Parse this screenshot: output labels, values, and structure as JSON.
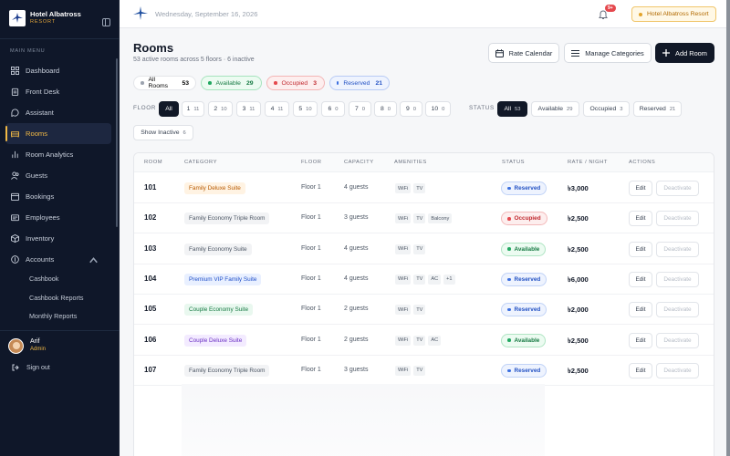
{
  "brand": {
    "name": "Hotel Albatross",
    "sub": "RESORT"
  },
  "sidebar": {
    "menu_label": "MAIN MENU",
    "items": [
      {
        "label": "Dashboard",
        "icon": "grid-icon"
      },
      {
        "label": "Front Desk",
        "icon": "clipboard-icon"
      },
      {
        "label": "Assistant",
        "icon": "chat-icon"
      },
      {
        "label": "Rooms",
        "icon": "bed-icon",
        "active": true
      },
      {
        "label": "Room Analytics",
        "icon": "bar-chart-icon"
      },
      {
        "label": "Guests",
        "icon": "users-icon"
      },
      {
        "label": "Bookings",
        "icon": "calendar-icon"
      },
      {
        "label": "Employees",
        "icon": "id-card-icon"
      },
      {
        "label": "Inventory",
        "icon": "box-icon"
      },
      {
        "label": "Accounts",
        "icon": "wallet-icon"
      }
    ],
    "sub_items": [
      "Cashbook",
      "Cashbook Reports",
      "Monthly Reports"
    ],
    "user": {
      "name": "Arif",
      "role": "Admin"
    },
    "signout": "Sign out"
  },
  "topbar": {
    "date": "Wednesday, September 16, 2026",
    "notif_badge": "9+",
    "hotel": "Hotel Albatross Resort"
  },
  "page": {
    "title": "Rooms",
    "subtitle": "53 active rooms across 5 floors · 6 inactive"
  },
  "actions": {
    "rate_calendar": "Rate Calendar",
    "manage_categories": "Manage Categories",
    "add_room": "Add Room"
  },
  "summary": [
    {
      "label": "All Rooms",
      "count": "53",
      "color": "#9ca3af"
    },
    {
      "label": "Available",
      "count": "29",
      "color": "#22a861"
    },
    {
      "label": "Occupied",
      "count": "3",
      "color": "#e5484d"
    },
    {
      "label": "Reserved",
      "count": "21",
      "color": "#3b6fe0"
    }
  ],
  "filters": {
    "floor_label": "FLOOR",
    "floors": [
      {
        "label": "All",
        "count": ""
      },
      {
        "label": "1",
        "count": "11"
      },
      {
        "label": "2",
        "count": "10"
      },
      {
        "label": "3",
        "count": "11"
      },
      {
        "label": "4",
        "count": "11"
      },
      {
        "label": "5",
        "count": "10"
      },
      {
        "label": "6",
        "count": "0"
      },
      {
        "label": "7",
        "count": "0"
      },
      {
        "label": "8",
        "count": "0"
      },
      {
        "label": "9",
        "count": "0"
      },
      {
        "label": "10",
        "count": "0"
      }
    ],
    "status_label": "STATUS",
    "statuses": [
      {
        "label": "All",
        "count": "53"
      },
      {
        "label": "Available",
        "count": "29"
      },
      {
        "label": "Occupied",
        "count": "3"
      },
      {
        "label": "Reserved",
        "count": "21"
      }
    ],
    "show_inactive": {
      "label": "Show Inactive",
      "count": "6"
    }
  },
  "table": {
    "headers": [
      "ROOM",
      "CATEGORY",
      "FLOOR",
      "CAPACITY",
      "AMENITIES",
      "STATUS",
      "RATE / NIGHT",
      "ACTIONS"
    ],
    "edit_label": "Edit",
    "deactivate_label": "Deactivate",
    "rows": [
      {
        "room": "101",
        "category": "Family Deluxe Suite",
        "cat_style": "orange",
        "floor": "Floor 1",
        "capacity": "4 guests",
        "amenities": [
          "WiFi",
          "TV"
        ],
        "status": "Reserved",
        "rate": "৳3,000"
      },
      {
        "room": "102",
        "category": "Family Economy Triple Room",
        "cat_style": "gray",
        "floor": "Floor 1",
        "capacity": "3 guests",
        "amenities": [
          "WiFi",
          "TV",
          "Balcony"
        ],
        "status": "Occupied",
        "rate": "৳2,500"
      },
      {
        "room": "103",
        "category": "Family Economy Suite",
        "cat_style": "gray",
        "floor": "Floor 1",
        "capacity": "4 guests",
        "amenities": [
          "WiFi",
          "TV"
        ],
        "status": "Available",
        "rate": "৳2,500"
      },
      {
        "room": "104",
        "category": "Premium VIP Family Suite",
        "cat_style": "blue",
        "floor": "Floor 1",
        "capacity": "4 guests",
        "amenities": [
          "WiFi",
          "TV",
          "AC",
          "+1"
        ],
        "status": "Reserved",
        "rate": "৳6,000"
      },
      {
        "room": "105",
        "category": "Couple Economy Suite",
        "cat_style": "green",
        "floor": "Floor 1",
        "capacity": "2 guests",
        "amenities": [
          "WiFi",
          "TV"
        ],
        "status": "Reserved",
        "rate": "৳2,000"
      },
      {
        "room": "106",
        "category": "Couple Deluxe Suite",
        "cat_style": "purple",
        "floor": "Floor 1",
        "capacity": "2 guests",
        "amenities": [
          "WiFi",
          "TV",
          "AC"
        ],
        "status": "Available",
        "rate": "৳2,500"
      },
      {
        "room": "107",
        "category": "Family Economy Triple Room",
        "cat_style": "gray",
        "floor": "Floor 1",
        "capacity": "3 guests",
        "amenities": [
          "WiFi",
          "TV"
        ],
        "status": "Reserved",
        "rate": "৳2,500"
      }
    ]
  },
  "colors": {
    "accent": "#f1b945",
    "sidebar_bg": "#0f1729",
    "primary_btn": "#111827"
  }
}
